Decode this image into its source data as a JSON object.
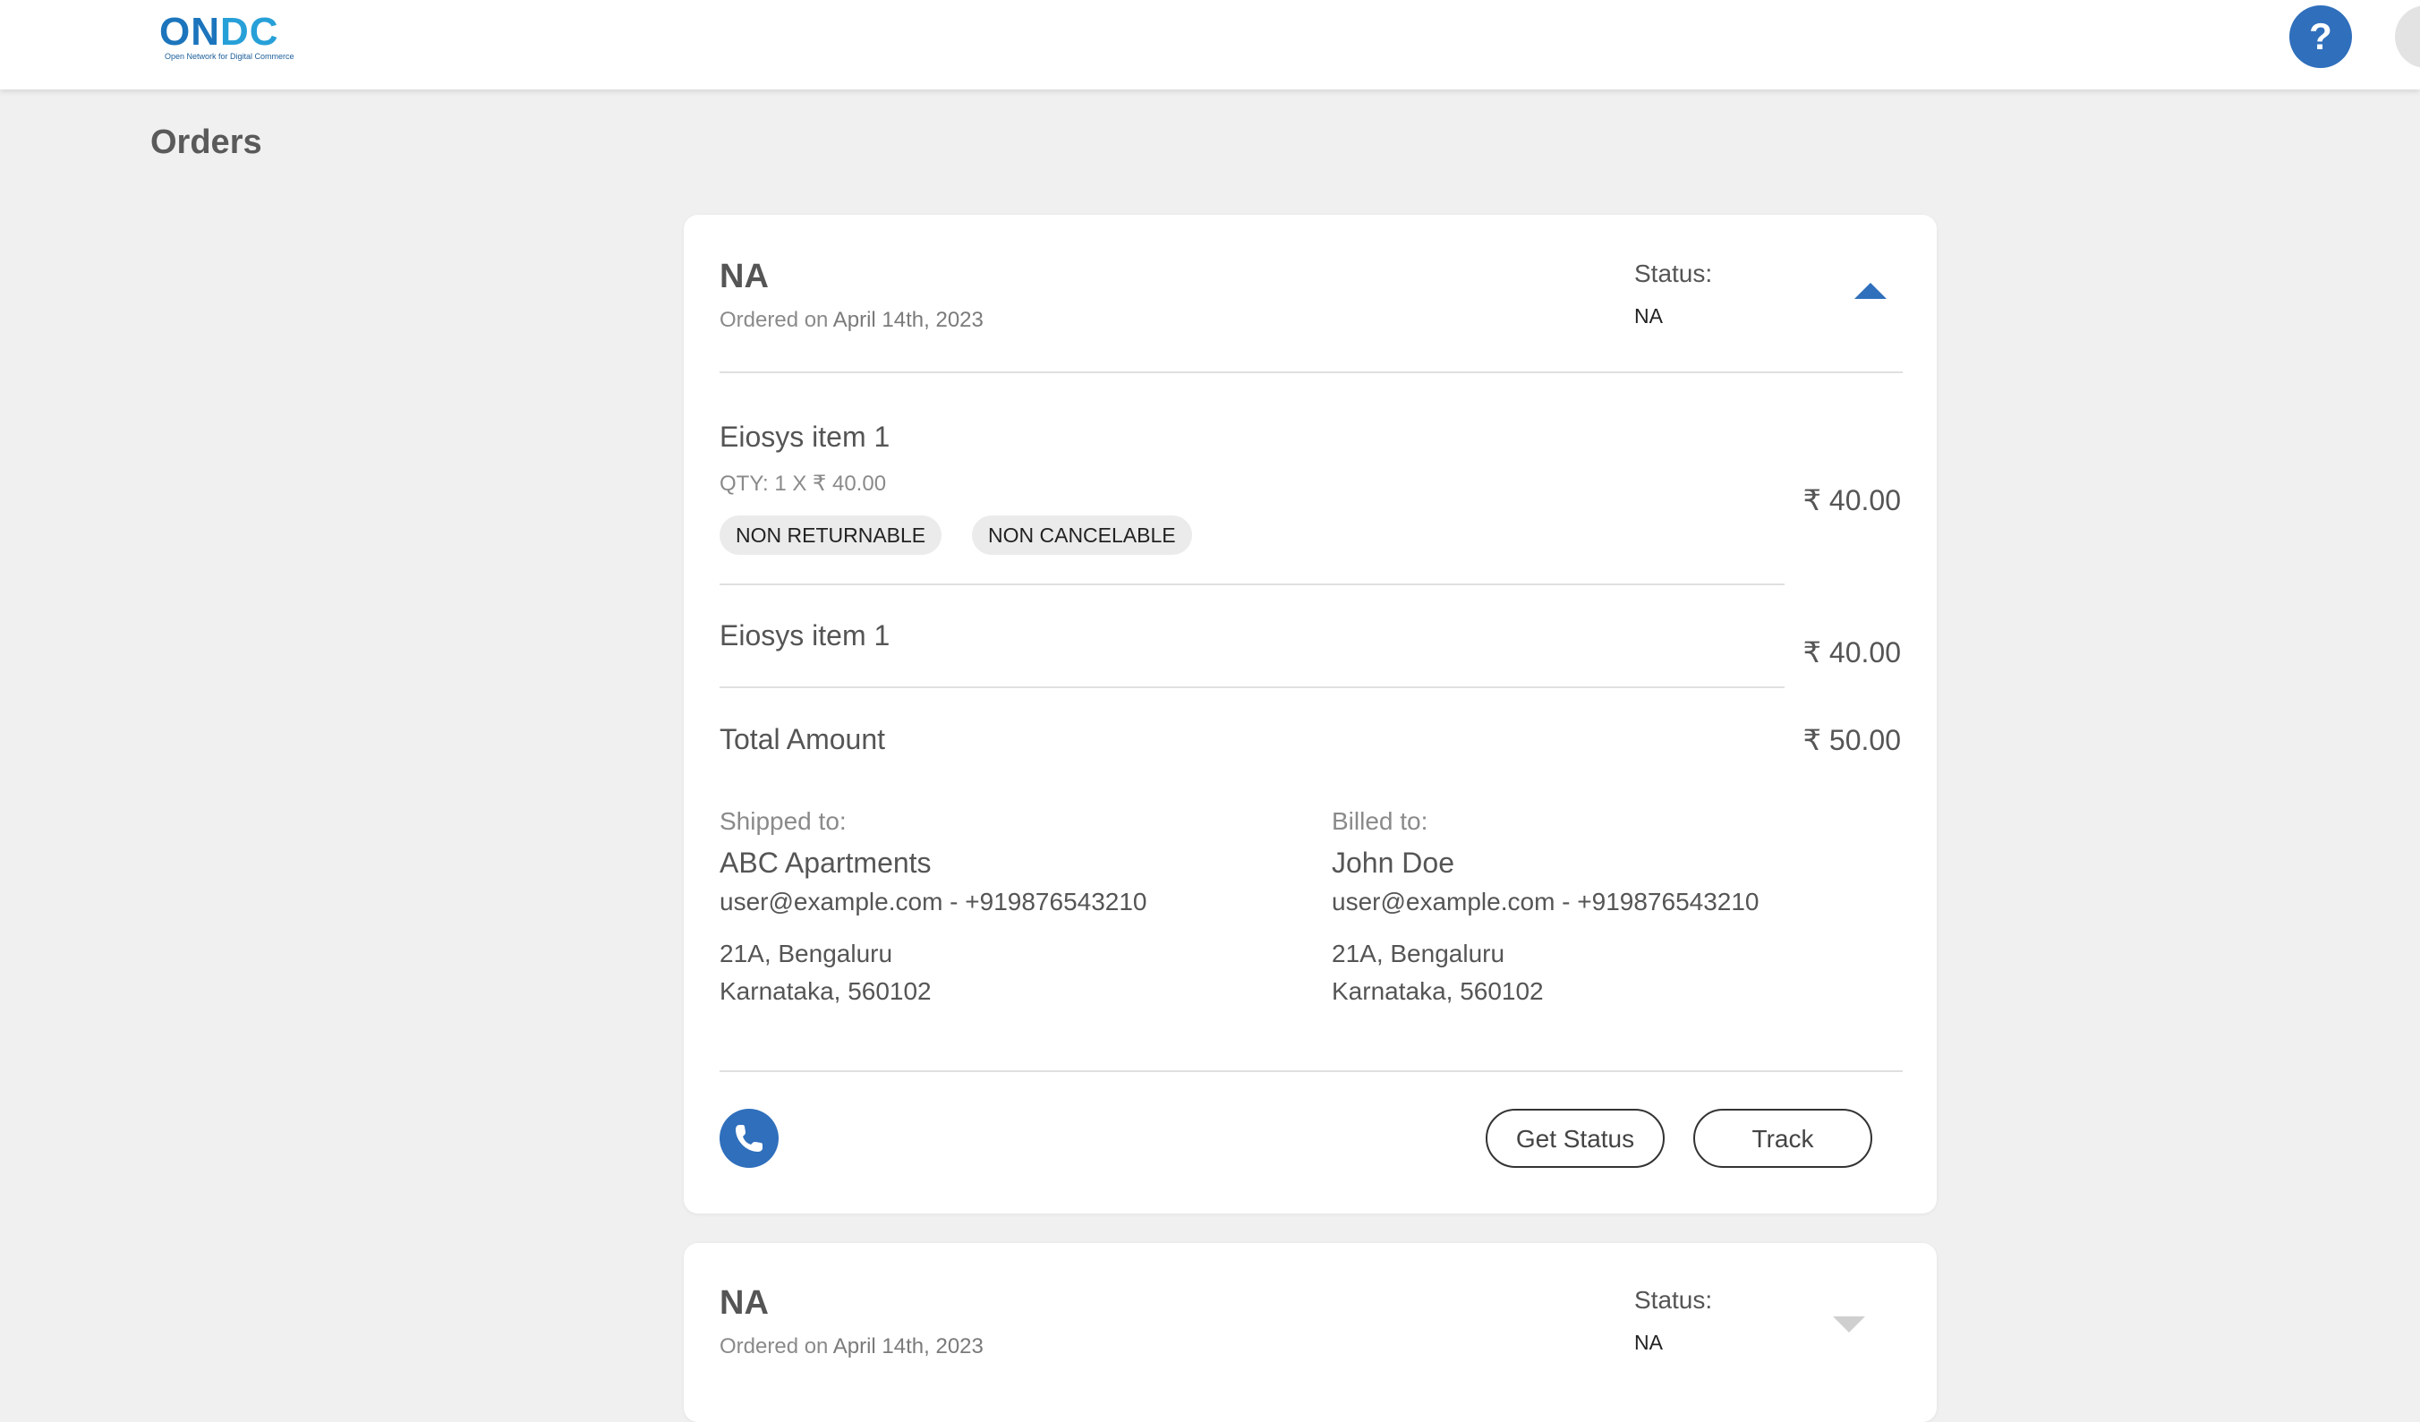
{
  "header": {
    "logo_text": "ONDC",
    "logo_tagline": "Open Network for Digital Commerce",
    "help_label": "?"
  },
  "page": {
    "title": "Orders"
  },
  "orders": [
    {
      "id": "NA",
      "ordered_on_label": "Ordered on",
      "ordered_on_date": "April 14th, 2023",
      "status_label": "Status:",
      "status_value": "NA",
      "expanded": true,
      "items": [
        {
          "name": "Eiosys item 1",
          "qty": "QTY: 1 X ₹ 40.00",
          "tags": [
            "NON RETURNABLE",
            "NON CANCELABLE"
          ],
          "price": "₹ 40.00"
        },
        {
          "name": "Eiosys item 1",
          "price": "₹ 40.00"
        }
      ],
      "total_label": "Total Amount",
      "total_value": "₹ 50.00",
      "shipped_to": {
        "label": "Shipped to:",
        "name": "ABC Apartments",
        "contact": "user@example.com - +919876543210",
        "line1": "21A, Bengaluru",
        "line2": "Karnataka, 560102"
      },
      "billed_to": {
        "label": "Billed to:",
        "name": "John Doe",
        "contact": "user@example.com - +919876543210",
        "line1": "21A, Bengaluru",
        "line2": "Karnataka, 560102"
      },
      "actions": {
        "get_status": "Get Status",
        "track": "Track"
      }
    },
    {
      "id": "NA",
      "ordered_on_label": "Ordered on",
      "ordered_on_date": "April 14th, 2023",
      "status_label": "Status:",
      "status_value": "NA",
      "expanded": false
    }
  ],
  "colors": {
    "accent": "#2f6fbc",
    "background": "#f0f0f0",
    "card": "#ffffff"
  },
  "icons": {
    "help": "question-mark-icon",
    "collapse": "chevron-up-icon",
    "expand": "chevron-down-icon",
    "phone": "phone-icon"
  }
}
